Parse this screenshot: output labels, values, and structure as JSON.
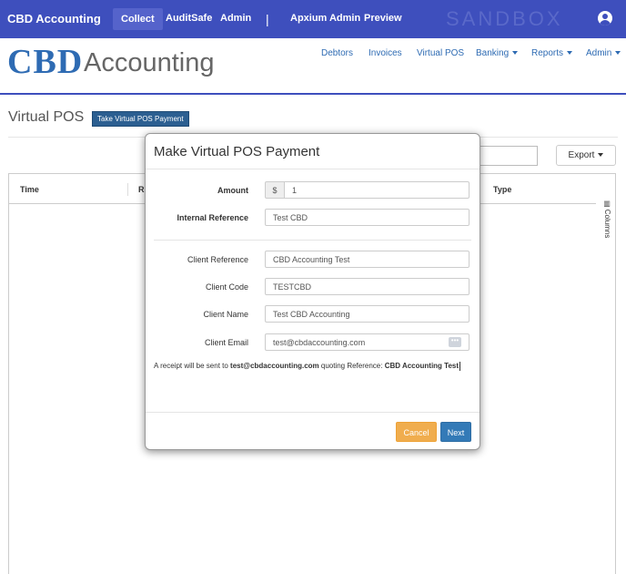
{
  "topbar": {
    "brand": "CBD Accounting",
    "nav": [
      "Collect",
      "AuditSafe",
      "Admin",
      "Apxium Admin",
      "Preview"
    ],
    "separator": "|",
    "watermark": "SANDBOX",
    "bg_color": "#3e4fbd"
  },
  "header": {
    "logo_abbr": "CBD",
    "logo_word": "Accounting",
    "menu": [
      "Debtors",
      "Invoices",
      "Virtual POS",
      "Banking",
      "Reports",
      "Admin"
    ]
  },
  "page": {
    "title": "Virtual POS",
    "take_payment_label": "Take Virtual POS Payment",
    "export_label": "Export",
    "columns_label": "Columns",
    "table_headers": [
      "Time",
      "R",
      "Type"
    ]
  },
  "modal": {
    "title": "Make Virtual POS Payment",
    "amount_label": "Amount",
    "currency_symbol": "$",
    "amount_value": "1",
    "internal_ref_label": "Internal Reference",
    "internal_ref_value": "Test CBD",
    "client_ref_label": "Client Reference",
    "client_ref_value": "CBD Accounting Test",
    "client_code_label": "Client Code",
    "client_code_value": "TESTCBD",
    "client_name_label": "Client Name",
    "client_name_value": "Test CBD Accounting",
    "client_email_label": "Client Email",
    "client_email_value": "test@cbdaccounting.com",
    "email_icon_text": "•••",
    "receipt_prefix": "A receipt will be sent to ",
    "receipt_email": "test@cbdaccounting.com",
    "receipt_middle": " quoting Reference: ",
    "receipt_reference": "CBD Accounting Test",
    "cancel_label": "Cancel",
    "next_label": "Next"
  }
}
